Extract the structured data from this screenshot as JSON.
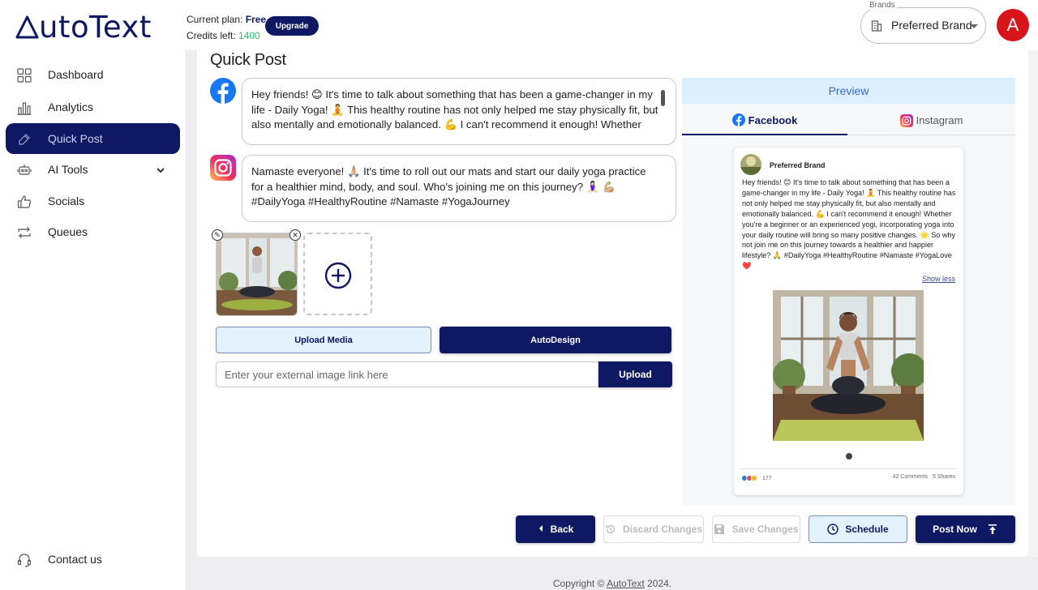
{
  "app": {
    "logo_text": "utoText",
    "colors": {
      "primary": "#0e1863",
      "accent_green": "#1fc26b",
      "avatar_red": "#d8141b"
    }
  },
  "header": {
    "plan_label": "Current plan: ",
    "plan_value": "Free",
    "credits_label": "Credits left: ",
    "credits_value": "1400",
    "upgrade_label": "Upgrade",
    "brands_legend": "Brands",
    "brand_selected": "Preferred Brand",
    "avatar_initial": "A"
  },
  "sidebar": {
    "items": [
      {
        "label": "Dashboard",
        "icon": "grid-icon"
      },
      {
        "label": "Analytics",
        "icon": "bar-chart-icon"
      },
      {
        "label": "Quick Post",
        "icon": "edit-icon",
        "active": true
      },
      {
        "label": "AI Tools",
        "icon": "robot-icon"
      },
      {
        "label": "Socials",
        "icon": "thumbs-up-icon"
      },
      {
        "label": "Queues",
        "icon": "repeat-icon"
      }
    ],
    "contact_label": "Contact us"
  },
  "main": {
    "title": "Quick Post",
    "facebook_text": "Hey friends! 😊 It's time to talk about something that has been a game-changer in my life - Daily Yoga! 🧘 This healthy routine has not only helped me stay physically fit, but also mentally and emotionally balanced. 💪 I can't recommend it enough! Whether",
    "instagram_text": "Namaste everyone! 🙏🏼 It's time to roll out our mats and start our daily yoga practice for a healthier mind, body, and soul. Who's joining me on this journey? 🧘🏻‍♀️ 💪🏼 #DailyYoga #HealthyRoutine #Namaste #YogaJourney",
    "upload_media_label": "Upload Media",
    "autodesign_label": "AutoDesign",
    "external_link_placeholder": "Enter your external image link here",
    "upload_label": "Upload"
  },
  "preview": {
    "header": "Preview",
    "tab_facebook": "Facebook",
    "tab_instagram": "Instagram",
    "brand_name": "Preferred Brand",
    "post_text": "Hey friends! 😊 It's time to talk about something that has been a game-changer in my life - Daily Yoga! 🧘 This healthy routine has not only helped me stay physically fit, but also mentally and emotionally balanced. 💪 I can't recommend it enough! Whether you're a beginner or an experienced yogi, incorporating yoga into your daily routine will bring so many positive changes. 🌟 So why not join me on this journey towards a healthier and happier lifestyle? 🙏 #DailyYoga #HealthyRoutine #Namaste #YogaLove ❤️",
    "show_less": "Show less",
    "reaction_count": "177",
    "comments": "42 Comments",
    "shares": "5 Shares"
  },
  "actions": {
    "back": "Back",
    "discard": "Discard Changes",
    "save": "Save Changes",
    "schedule": "Schedule",
    "post_now": "Post Now"
  },
  "footer": {
    "copyright_prefix": "Copyright © ",
    "copyright_link": "AutoText",
    "copyright_suffix": " 2024."
  }
}
